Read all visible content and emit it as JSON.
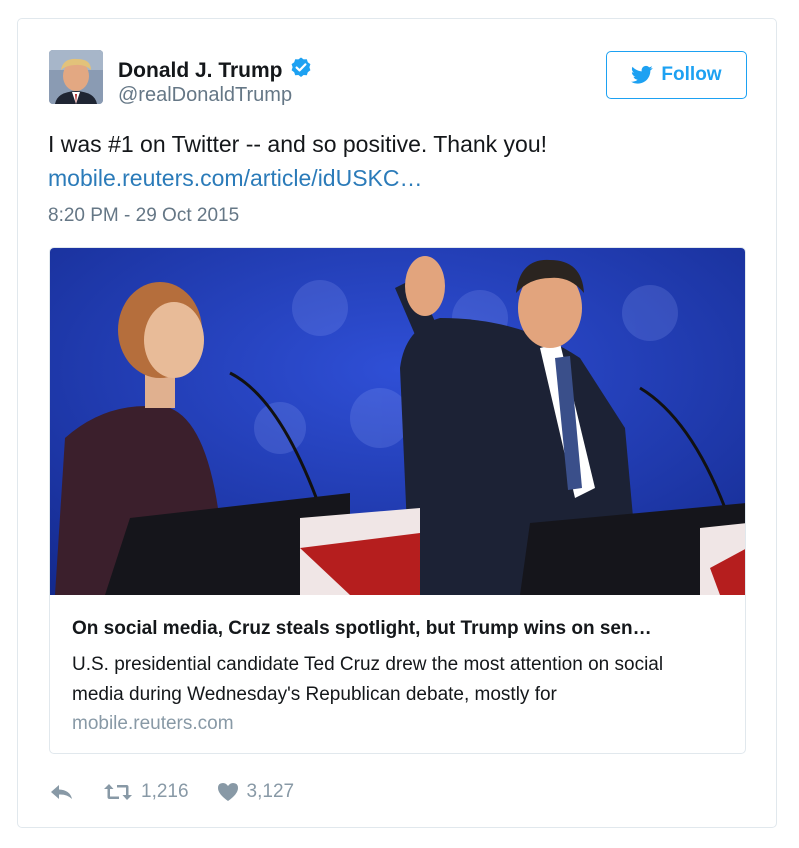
{
  "author": {
    "name": "Donald J. Trump",
    "handle": "@realDonaldTrump",
    "verified": true
  },
  "follow_button": {
    "label": "Follow",
    "icon": "twitter-bird-icon"
  },
  "tweet": {
    "text": "I was #1 on Twitter -- and so positive. Thank you!",
    "link": "mobile.reuters.com/article/idUSKC…",
    "timestamp": "8:20 PM - 29 Oct 2015"
  },
  "card": {
    "title": "On social media, Cruz steals spotlight, but Trump wins on sen…",
    "description": "U.S. presidential candidate Ted Cruz drew the most attention on social media during Wednesday's Republican debate, mostly for",
    "domain": "mobile.reuters.com"
  },
  "actions": {
    "reply_icon": "reply-icon",
    "retweet_icon": "retweet-icon",
    "retweets": "1,216",
    "like_icon": "heart-icon",
    "likes": "3,127"
  },
  "colors": {
    "accent": "#1da1f2",
    "link": "#2b7bb9",
    "secondary_text": "#657786",
    "action_gray": "#8899a6"
  }
}
